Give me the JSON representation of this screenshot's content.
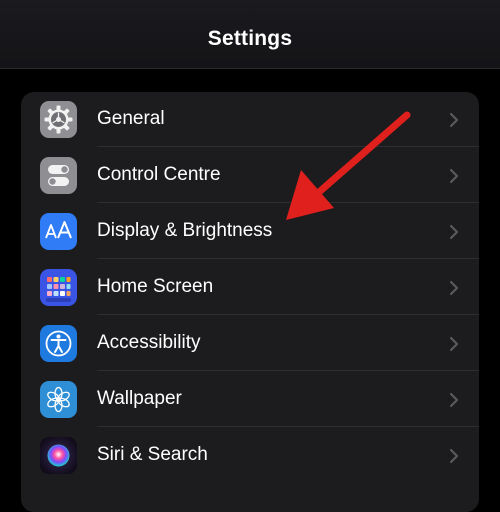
{
  "header": {
    "title": "Settings"
  },
  "settings": {
    "items": [
      {
        "label": "General",
        "icon": "gear-icon",
        "color": "#8e8e93"
      },
      {
        "label": "Control Centre",
        "icon": "toggles-icon",
        "color": "#8e8e93"
      },
      {
        "label": "Display & Brightness",
        "icon": "text-size-icon",
        "color": "#2f7cf6"
      },
      {
        "label": "Home Screen",
        "icon": "app-grid-icon",
        "color": "#3a55e6"
      },
      {
        "label": "Accessibility",
        "icon": "accessibility-icon",
        "color": "#1f7ae0"
      },
      {
        "label": "Wallpaper",
        "icon": "flower-icon",
        "color": "#2f8fd6"
      },
      {
        "label": "Siri & Search",
        "icon": "siri-icon",
        "color": "#2a1a3a"
      }
    ]
  },
  "annotation": {
    "arrow_color": "#e0201d",
    "points_to": "Display & Brightness"
  }
}
